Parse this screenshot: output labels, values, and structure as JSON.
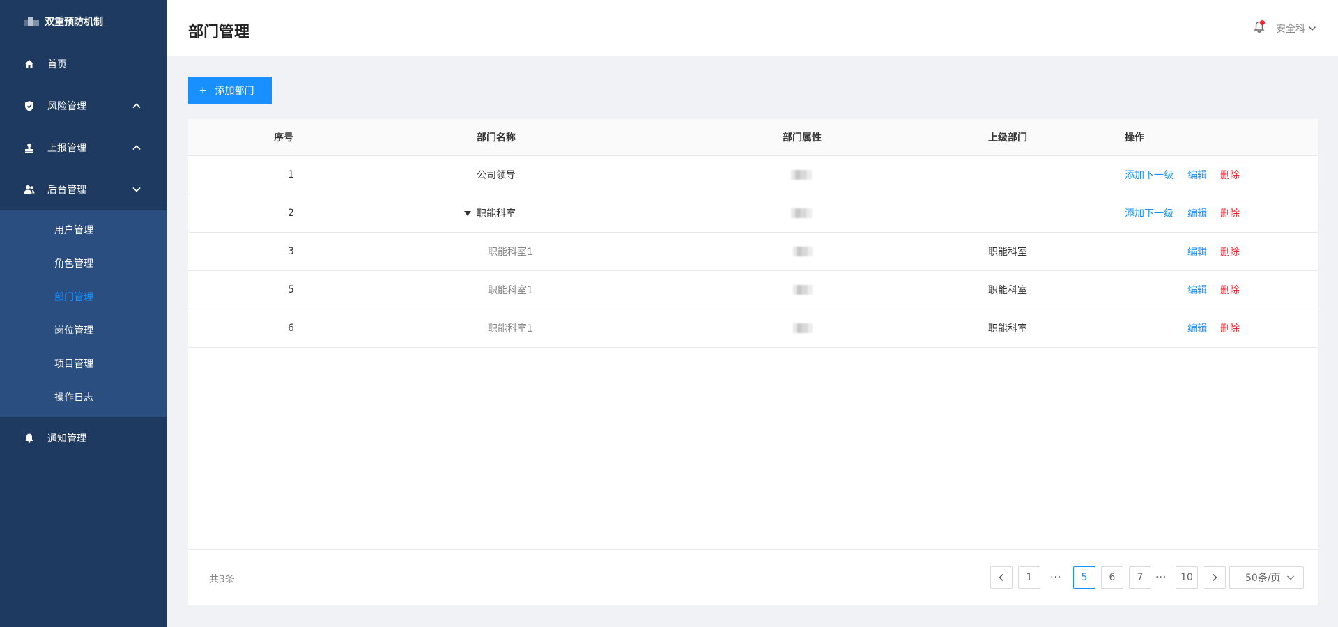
{
  "app": {
    "name": "双重预防机制"
  },
  "sidebar": {
    "items": [
      {
        "label": "首页",
        "icon": "home-icon"
      },
      {
        "label": "风险管理",
        "icon": "shield-icon",
        "arrow": "up"
      },
      {
        "label": "上报管理",
        "icon": "stamp-icon",
        "arrow": "up"
      },
      {
        "label": "后台管理",
        "icon": "users-icon",
        "arrow": "down"
      }
    ],
    "sub_items": [
      {
        "label": "用户管理",
        "active": false
      },
      {
        "label": "角色管理",
        "active": false
      },
      {
        "label": "部门管理",
        "active": true
      },
      {
        "label": "岗位管理",
        "active": false
      },
      {
        "label": "项目管理",
        "active": false
      },
      {
        "label": "操作日志",
        "active": false
      }
    ],
    "notify": {
      "label": "通知管理",
      "icon": "bell-icon"
    }
  },
  "header": {
    "title": "部门管理",
    "user": "安全科"
  },
  "toolbar": {
    "add_label": "添加部门"
  },
  "table": {
    "columns": [
      "序号",
      "部门名称",
      "部门属性",
      "上级部门",
      "操作"
    ],
    "rows": [
      {
        "index": "1",
        "name": "公司领导",
        "parent": "",
        "actions": [
          "添加下一级",
          "编辑",
          "删除"
        ],
        "expand": false,
        "child": false
      },
      {
        "index": "2",
        "name": "职能科室",
        "parent": "",
        "actions": [
          "添加下一级",
          "编辑",
          "删除"
        ],
        "expand": true,
        "child": false
      },
      {
        "index": "3",
        "name": "职能科室1",
        "parent": "职能科室",
        "actions": [
          "编辑",
          "删除"
        ],
        "expand": false,
        "child": true
      },
      {
        "index": "5",
        "name": "职能科室1",
        "parent": "职能科室",
        "actions": [
          "编辑",
          "删除"
        ],
        "expand": false,
        "child": true
      },
      {
        "index": "6",
        "name": "职能科室1",
        "parent": "职能科室",
        "actions": [
          "编辑",
          "删除"
        ],
        "expand": false,
        "child": true
      }
    ]
  },
  "pagination": {
    "total": "共3条",
    "pages": [
      "1",
      "5",
      "6",
      "7",
      "10"
    ],
    "current": "5",
    "page_size": "50条/页"
  },
  "colors": {
    "sidebar": "#1f3a60",
    "submenu": "#2a4e7f",
    "accent": "#1890ff",
    "danger": "#f5222d"
  }
}
